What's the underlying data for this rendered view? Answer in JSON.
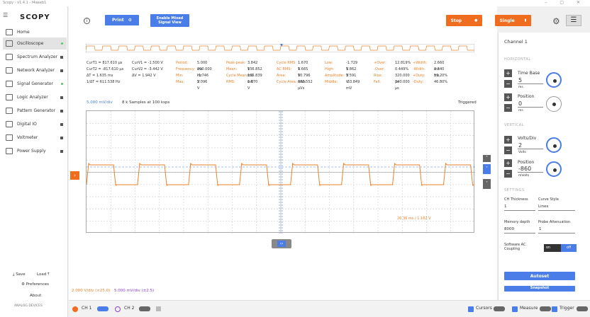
{
  "window": {
    "title": "Scopy - v1.4.1 - f4aeeb1",
    "controls": "– ▢ ✕"
  },
  "app": {
    "logo_text": "SCOPY"
  },
  "sidebar": {
    "home": "Home",
    "items": [
      {
        "label": "Oscilloscope",
        "indicator": "green"
      },
      {
        "label": "Spectrum Analyzer",
        "indicator": "gray"
      },
      {
        "label": "Network Analyzer",
        "indicator": "gray"
      },
      {
        "label": "Signal Generator",
        "indicator": "green"
      },
      {
        "label": "Logic Analyzer",
        "indicator": "gray"
      },
      {
        "label": "Pattern Generator",
        "indicator": "gray"
      },
      {
        "label": "Digital IO",
        "indicator": "gray"
      },
      {
        "label": "Voltmeter",
        "indicator": "gray"
      },
      {
        "label": "Power Supply",
        "indicator": "gray"
      }
    ],
    "save": "Save",
    "load": "Load",
    "preferences": "Preferences",
    "about": "About",
    "brand": "ANALOG DEVICES"
  },
  "toolbar": {
    "print": "Print",
    "mixed": "Enable Mixed Signal View",
    "stop": "Stop",
    "single": "Single"
  },
  "cursors": {
    "col1": [
      "CurT1 = 817.610 μs",
      "CurT2 = -817.610 μs",
      "ΔT = 1.635 ms",
      "1/ΔT = 611.538 Hz"
    ],
    "col2": [
      "CurV1 = -1.500 V",
      "CurV2 = -3.442 V",
      "ΔV = 1.942 V"
    ]
  },
  "measurements": [
    [
      "Period:",
      "5.000 ms",
      "Frequency:",
      "200.000 Hz",
      "Min:",
      "-1.746 V",
      "Max:",
      "2.096 V"
    ],
    [
      "Peak-peak:",
      "3.842 V",
      "Mean:",
      "136.852 mV",
      "Cycle Mean:",
      "135.839 mV",
      "RMS:",
      "1.670 V"
    ],
    [
      "Cycle RMS:",
      "1.670 V",
      "AC RMS:",
      "1.665 V",
      "Area:",
      "10.796 mVs",
      "Cycle Area:",
      "680.552 μVs"
    ],
    [
      "Low:",
      "-1.729 V",
      "High:",
      "1.862 V",
      "Amplitude:",
      "3.591 V",
      "Middle:",
      "-33.849 mV"
    ],
    [
      "+Over:",
      "12.819%",
      "-Over:",
      "0.449%",
      "Rise:",
      "320.000 μs",
      "Fall:",
      "340.000 μs"
    ],
    [
      "+Width:",
      "2.660 ms",
      "-Width:",
      "2.340 ms",
      "+Duty:",
      "53.20%",
      "-Duty:",
      "46.80%"
    ]
  ],
  "plot": {
    "vdiv": "5.000 mV/div",
    "samples": "8 k Samples at 100 ksps",
    "status": "Triggered",
    "cursor_readout": "20.36 ms / 1.162 V"
  },
  "channel_scales": {
    "ch1": "2.000 V/div (×25.0)",
    "ch2": "5.000 mV/div (±2.5)"
  },
  "panel": {
    "title": "Channel 1",
    "horizontal": "HORIZONTAL",
    "timebase_label": "Time Base",
    "timebase_value": "5",
    "timebase_unit": "ms",
    "hpos_label": "Position",
    "hpos_value": "0",
    "hpos_unit": "ms",
    "vertical": "VERTICAL",
    "vdiv_label": "Volts/Div",
    "vdiv_value": "2",
    "vdiv_unit": "Volts",
    "vpos_label": "Position",
    "vpos_value": "-860",
    "vpos_unit": "mVolts",
    "settings": "SETTINGS",
    "thickness_label": "CH Thickness",
    "thickness_value": "1",
    "curve_label": "Curve Style",
    "curve_value": "Lines",
    "memdepth_label": "Memory depth",
    "memdepth_value": "8000",
    "probe_label": "Probe Attenuation",
    "probe_value": "1",
    "swac_label": "Software AC Coupling",
    "on": "on",
    "off": "off",
    "autoset": "Autoset",
    "snapshot": "Snapshot"
  },
  "bottom": {
    "ch1": "CH 1",
    "ch2": "CH 2",
    "cursors": "Cursors",
    "measure": "Measure",
    "trigger": "Trigger"
  },
  "colors": {
    "accent": "#4a7de8",
    "ch1": "#e8832b",
    "stop": "#f06c1e"
  }
}
